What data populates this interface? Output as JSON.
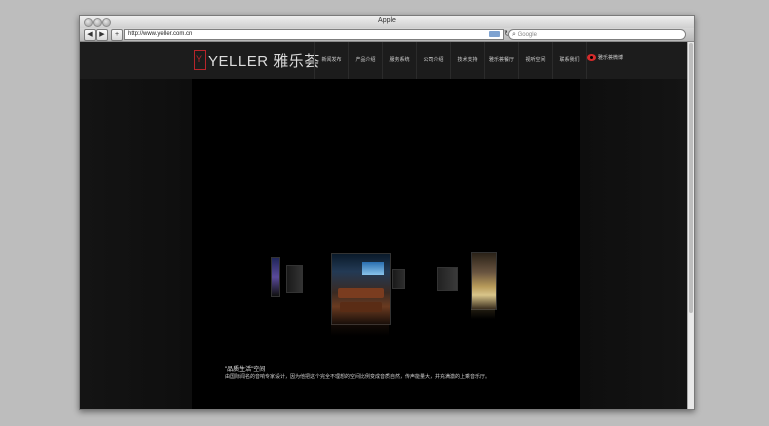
{
  "window": {
    "title": "Apple"
  },
  "toolbar": {
    "back_label": "◀",
    "forward_label": "▶",
    "add_label": "+",
    "url": "http://www.yeller.com.cn",
    "search_placeholder": "Google"
  },
  "site": {
    "logo_mark": "Y",
    "logo_text": "YELLER 雅乐荟",
    "menu": [
      "新闻发布",
      "产品介绍",
      "服务系统",
      "公司介绍",
      "技术支持",
      "雅乐荟餐厅",
      "视听空间",
      "联系我们"
    ],
    "weibo_label": "雅乐荟微博",
    "caption_title": "\"品质生活\"空间",
    "caption_desc": "由国际闻名的音响专家设计，因为他把这个完全不理想的空间比例变成音质自然，传声能量大，并充满激的上乘音乐厅。"
  },
  "colors": {
    "brand_red": "#b8252b",
    "nav_bg": "#1c1c1c"
  }
}
